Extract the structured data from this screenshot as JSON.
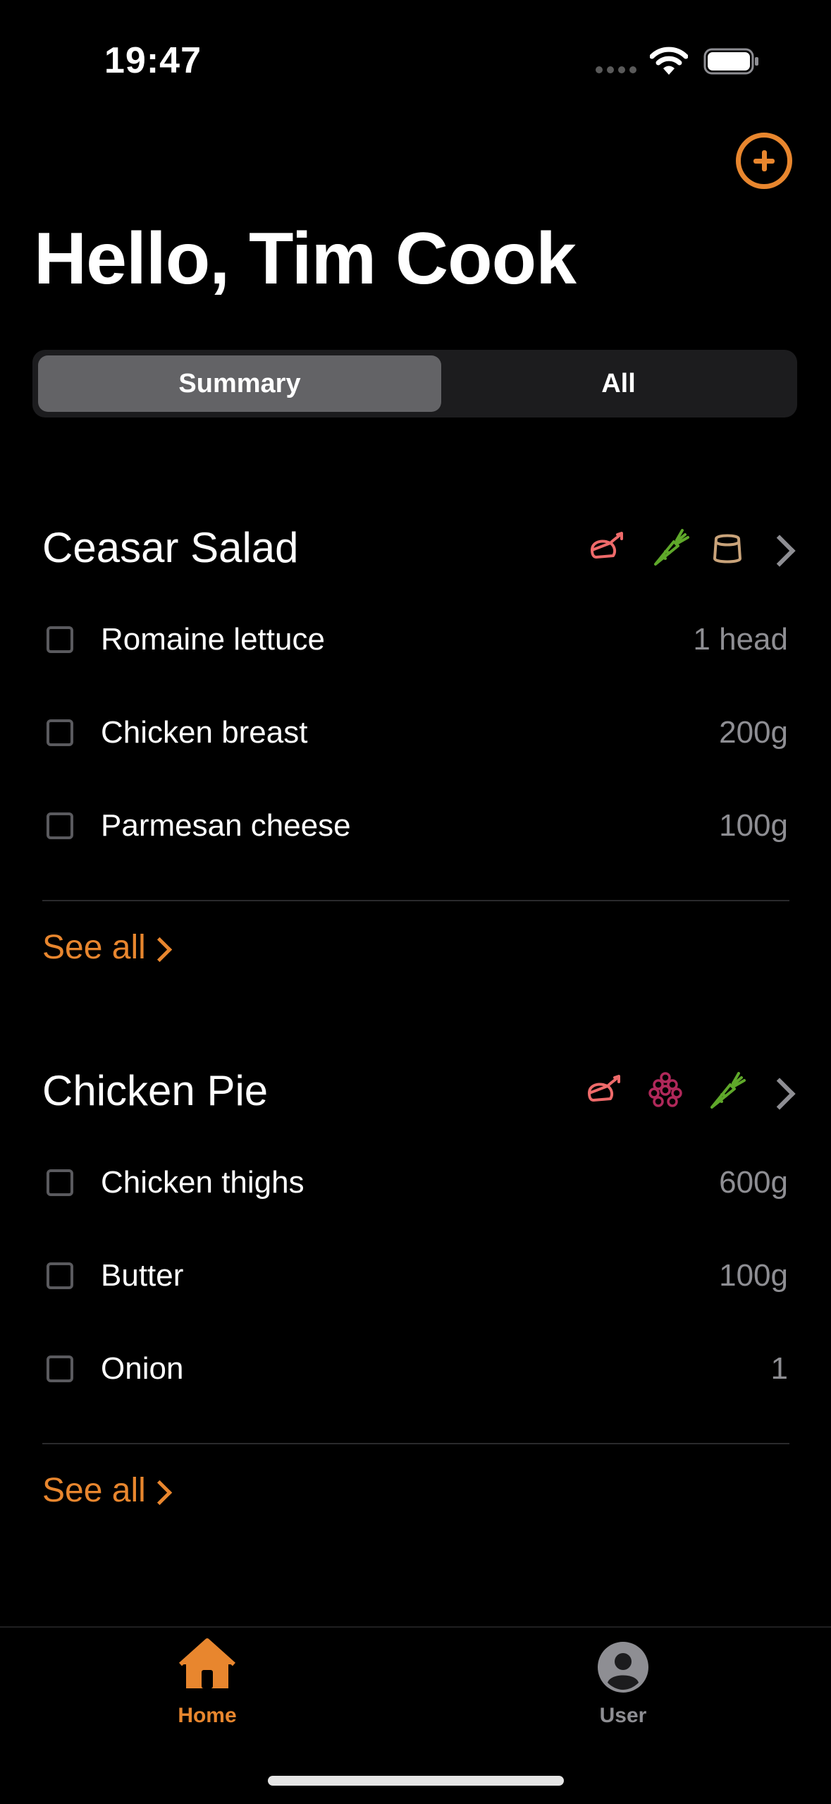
{
  "status_bar": {
    "time": "19:47"
  },
  "header": {
    "greeting": "Hello, Tim Cook"
  },
  "segmented": {
    "summary": "Summary",
    "all": "All"
  },
  "recipes": [
    {
      "title": "Ceasar Salad",
      "icons": [
        "poultry-icon",
        "carrot-icon",
        "cheese-icon"
      ],
      "items": [
        {
          "name": "Romaine lettuce",
          "qty": "1 head"
        },
        {
          "name": "Chicken breast",
          "qty": "200g"
        },
        {
          "name": "Parmesan cheese",
          "qty": "100g"
        }
      ],
      "see_all": "See all"
    },
    {
      "title": "Chicken Pie",
      "icons": [
        "poultry-icon",
        "grapes-icon",
        "carrot-icon"
      ],
      "items": [
        {
          "name": "Chicken thighs",
          "qty": "600g"
        },
        {
          "name": "Butter",
          "qty": "100g"
        },
        {
          "name": "Onion",
          "qty": "1"
        }
      ],
      "see_all": "See all"
    }
  ],
  "tabbar": {
    "home": "Home",
    "user": "User"
  },
  "colors": {
    "accent": "#E8862E",
    "poultry": "#EE6A6A",
    "carrot": "#5FA82A",
    "cheese": "#C9A37A",
    "grapes": "#B0285A"
  }
}
